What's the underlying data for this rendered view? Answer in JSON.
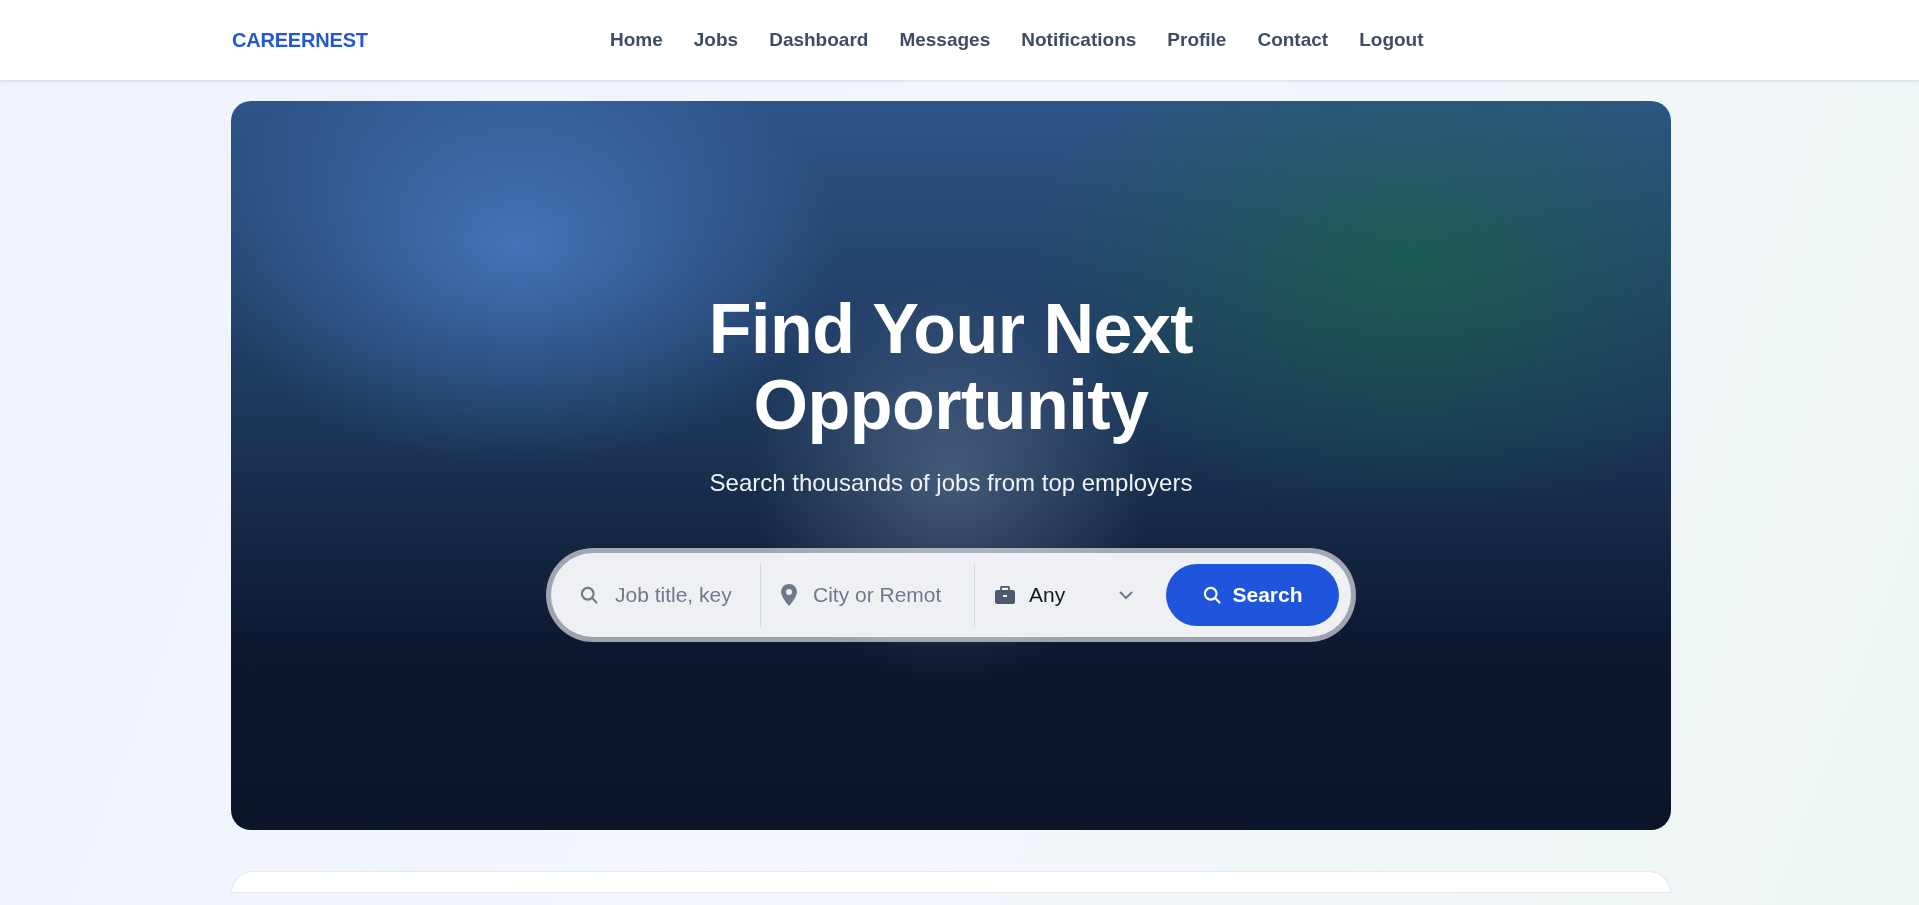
{
  "header": {
    "logo": "CAREERNEST",
    "nav": [
      {
        "label": "Home"
      },
      {
        "label": "Jobs"
      },
      {
        "label": "Dashboard"
      },
      {
        "label": "Messages"
      },
      {
        "label": "Notifications"
      },
      {
        "label": "Profile"
      },
      {
        "label": "Contact"
      },
      {
        "label": "Logout"
      }
    ]
  },
  "hero": {
    "title_lines": [
      "Find Your Next",
      "Opportunity"
    ],
    "subtitle": "Search thousands of jobs from top employers",
    "search": {
      "keyword": {
        "placeholder": "Job title, key"
      },
      "location": {
        "placeholder": "City or Remot"
      },
      "job_type": {
        "value": "Any"
      },
      "button": "Search"
    }
  }
}
